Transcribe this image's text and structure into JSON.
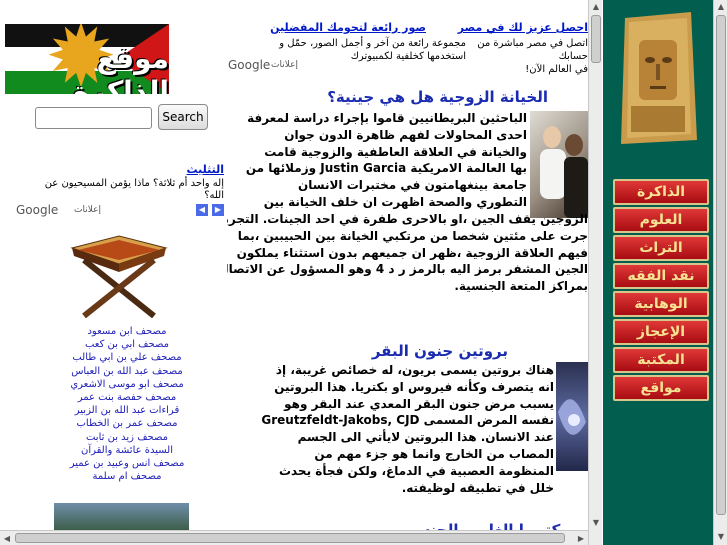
{
  "logo": {
    "text": "موقع الذاكرة"
  },
  "search": {
    "placeholder": "",
    "button_label": "Search"
  },
  "left_ad": {
    "title": "التثليث",
    "line1": "إله واحد أم ثلاثة؟ ماذا يؤمن المسيحيون عن",
    "line2": "الله؟",
    "google": "Google",
    "ads_label": "إعلانات"
  },
  "mushaf_links": [
    "مصحف ابن مسعود",
    "مصحف ابي بن كعب",
    "مصحف علي بن ابي طالب",
    "مصحف عبد الله بن العباس",
    "مصحف ابو موسى الاشعري",
    "مصحف حفصة بنت عمر",
    "قراءات عبد الله بن الزبير",
    "مصحف عمر بن الخطاب",
    "مصحف زيد بن ثابت",
    "السيدة عائشة والقرآن",
    "مصحف انس وعبيد بن عمير",
    "مصحف ام سلمة"
  ],
  "top_ad": {
    "ad1": {
      "title": "احصل عزيز لك في مصر",
      "line1": "اتصل في مصر مباشرة من حسابك",
      "line2": "في العالم الآن!"
    },
    "ad2": {
      "title": "صور رائعة لتحومك المفضلين",
      "line1": "مجموعة رائعة من آخر و أجمل الصور، حمّل و",
      "line2": "استخدمها كخلفية لكمبيوترك"
    },
    "google": "Google",
    "ads_label": "إعلانات"
  },
  "article1": {
    "heading": "الخيانة الزوجية هل هي جينية؟",
    "lines": [
      "الباحثين البريطانيين قاموا بإجراء دراسة لمعرفة",
      "احدى المحاولات لفهم ظاهرة الدون جوان",
      "والخيانة في العلاقة العاطفية والزوجية قامت",
      "بها العالمة الامريكية Justin Garcia وزملائها من",
      "جامعة بينغهامتون في مختبرات الانسان",
      "التطوري والصحة اظهرت ان خلف الخيانة بين",
      "الزوجين يقف الجين ،او بالاحرى طفرة في احد الجينات. التجربة",
      "جرت على مئتين شخصا من مرتكبي الخيانة بين الحبيبين ،بما",
      "فيهم العلاقة الزوجية ،ظهر ان جميعهم بدون استثناء يملكون",
      "الجين المشفر برمز اليه بالرمز ر د 4 وهو المسؤول عن الاتصال",
      "بمراكز المتعة الجنسية."
    ]
  },
  "article2": {
    "heading": "بروتين جنون البقر",
    "lines": [
      "هناك بروتين يسمى بريون، له خصائص غريبة، إذ",
      "انه يتصرف وكأنه فيروس او بكتريا. هذا البروتين",
      "يسبب مرض جنون البقر المعدي عند البقر وهو",
      "نفسه المرض المسمى Greutzfeldt-Jakobs, CJD",
      "عند الانسان. هذا البروتين لايأتي الى الجسم",
      "المصاب من الخارج وانما هو جزء مهم من",
      "المنظومة العصبية في الدماغ، ولكن فجأة يحدث",
      "خلل في تطبيقه لوظيفته."
    ]
  },
  "article3": {
    "heading": "بكتيريا الغلي والجنس"
  },
  "nav": [
    "الذاكرة",
    "العلوم",
    "التراث",
    "نقد الفقه",
    "الوهابية",
    "الإعجاز",
    "المكتبة",
    "مواقع"
  ],
  "colors": {
    "nav_bg": "#025f50",
    "nav_button": "#c41f23",
    "heading_blue": "#1b2cb0",
    "link_blue": "#1b1bb8"
  }
}
